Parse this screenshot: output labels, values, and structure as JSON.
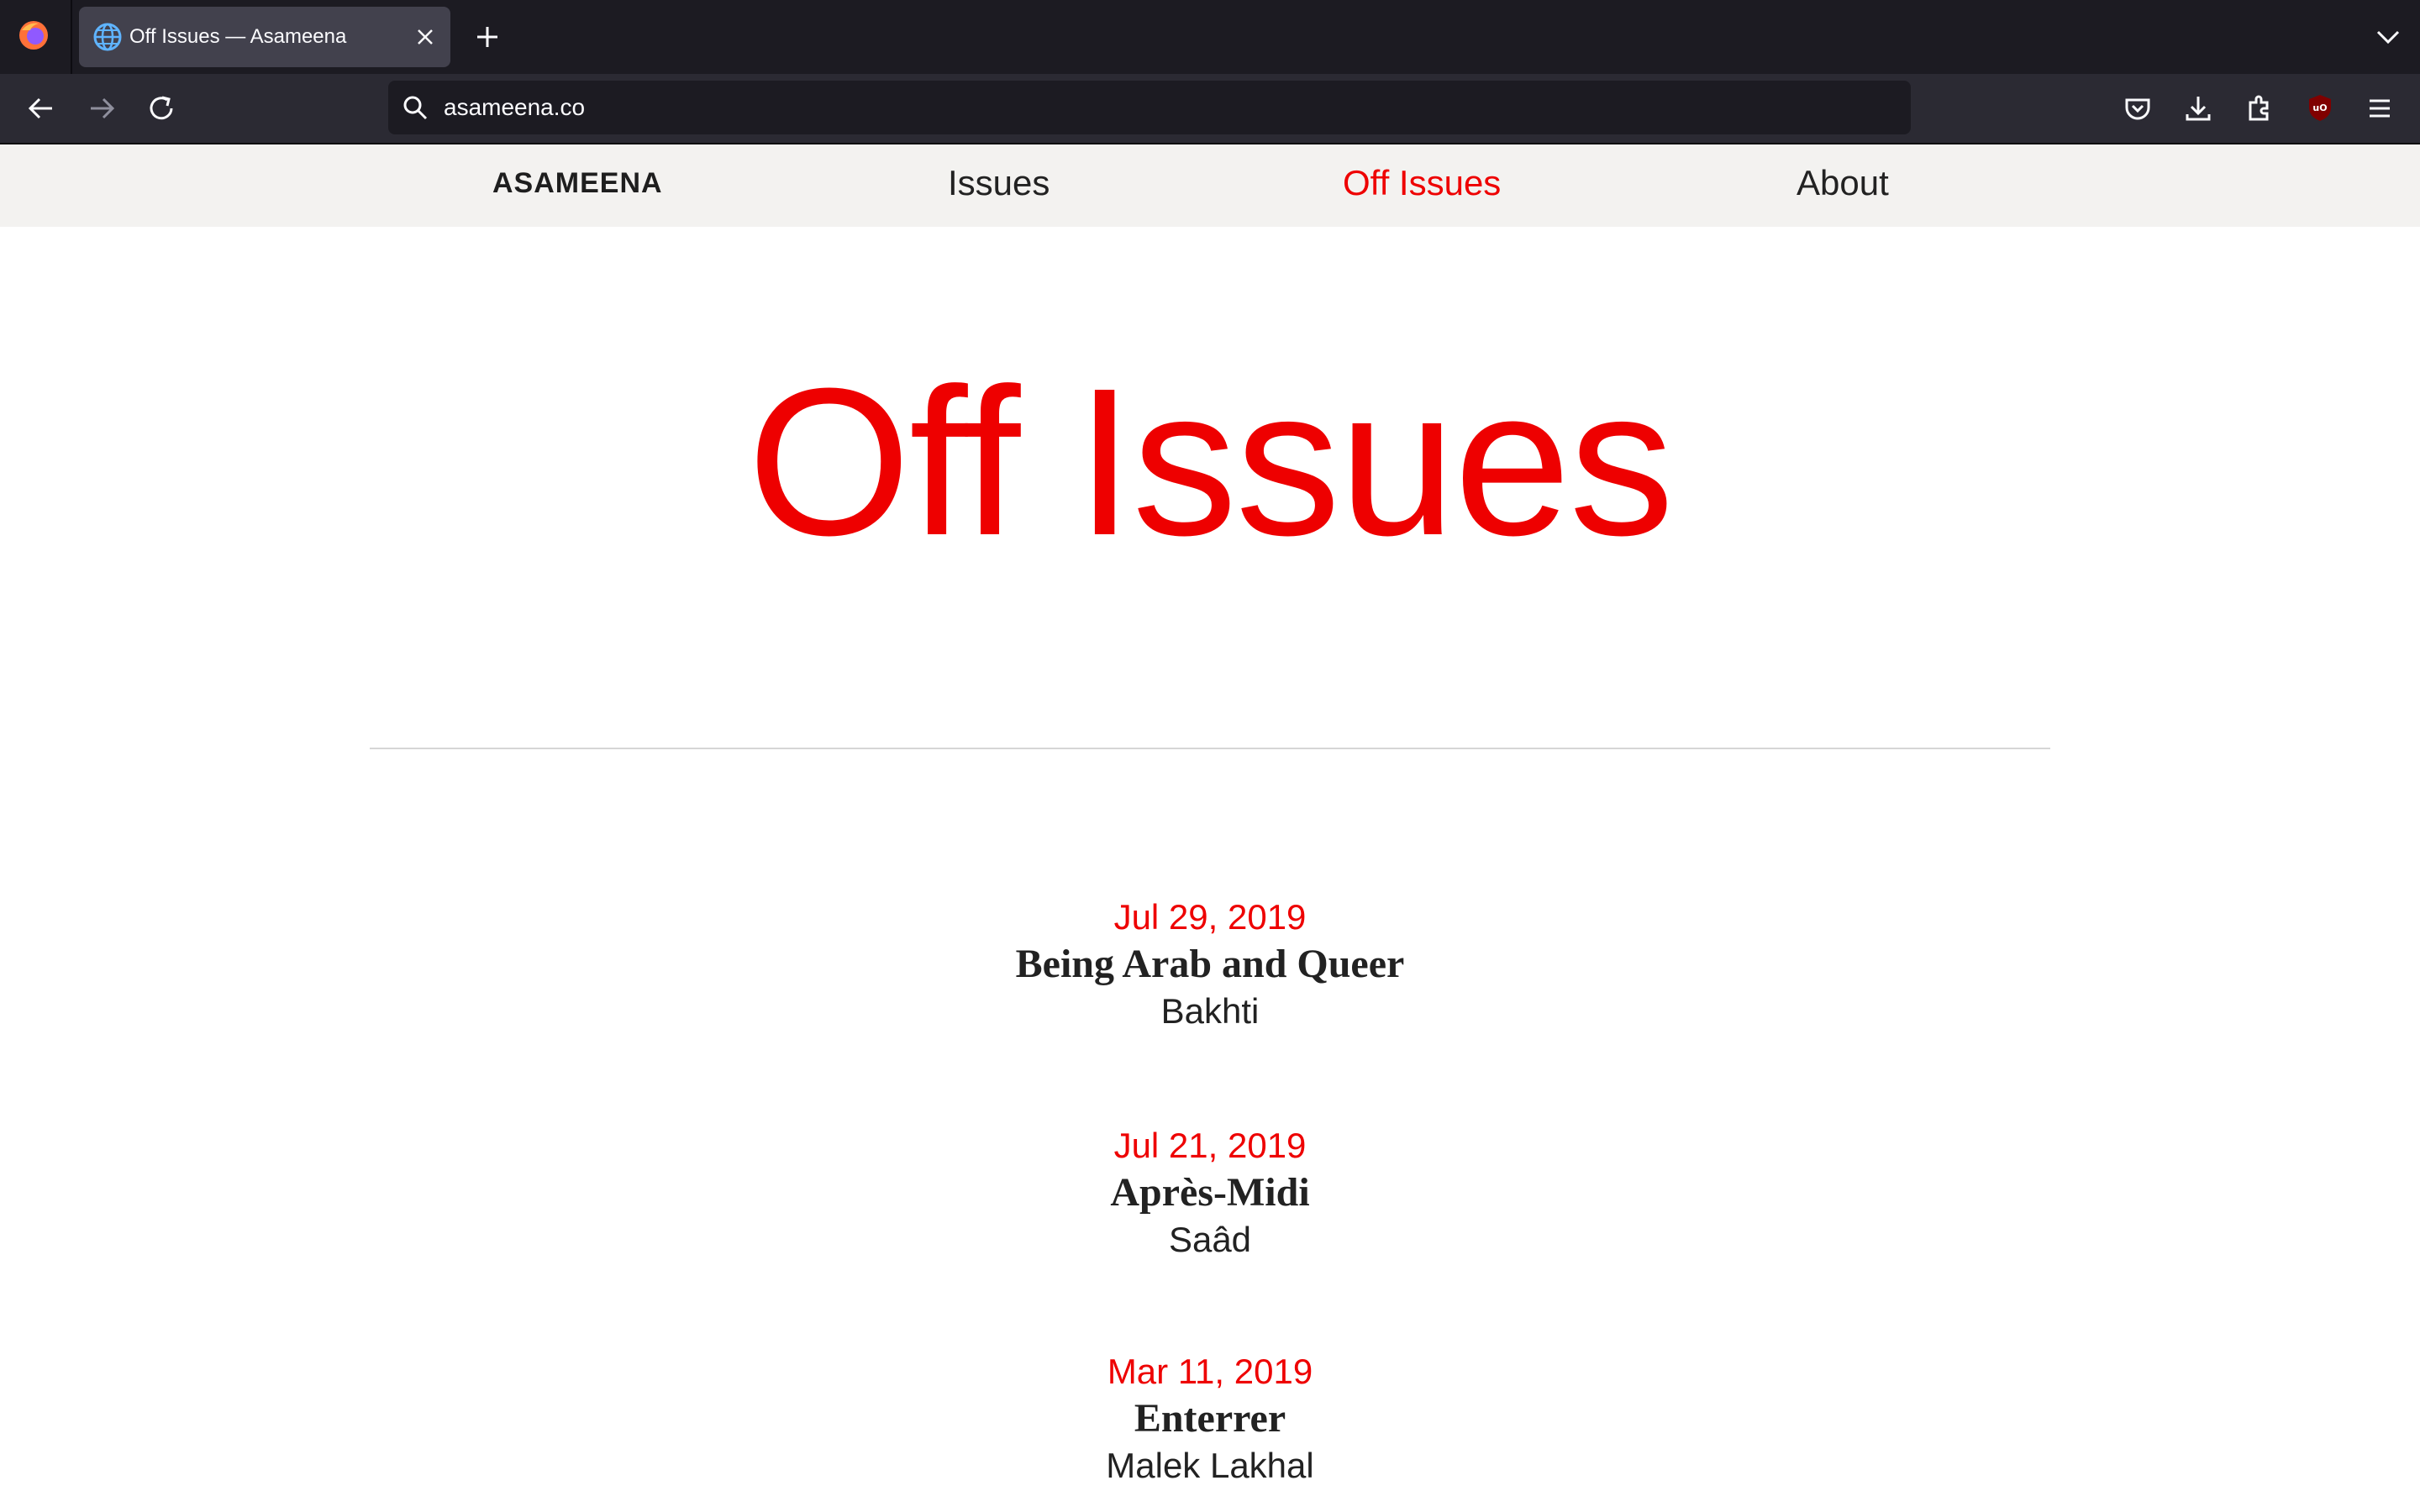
{
  "browser": {
    "tab_title": "Off Issues — Asameena",
    "url": "asameena.co",
    "icons": [
      "firefox-icon",
      "globe-icon",
      "close-icon",
      "plus-icon",
      "chevron-down-icon",
      "back-icon",
      "forward-icon",
      "reload-icon",
      "search-icon",
      "pocket-icon",
      "download-icon",
      "extensions-icon",
      "ublock-icon",
      "menu-icon"
    ]
  },
  "nav": {
    "brand": "ASAMEENA",
    "issues": "Issues",
    "off_issues": "Off Issues",
    "about": "About"
  },
  "page": {
    "heading": "Off Issues",
    "posts": [
      {
        "date": "Jul 29, 2019",
        "title": "Being Arab and Queer",
        "author": "Bakhti"
      },
      {
        "date": "Jul 21, 2019",
        "title": "Après-Midi",
        "author": "Saâd"
      },
      {
        "date": "Mar 11, 2019",
        "title": "Enterrer",
        "author": "Malek Lakhal"
      }
    ]
  },
  "colors": {
    "accent": "#ee0000",
    "nav_bg": "#f3f2f0",
    "chrome_dark": "#1c1b22",
    "chrome_toolbar": "#2b2a33"
  }
}
